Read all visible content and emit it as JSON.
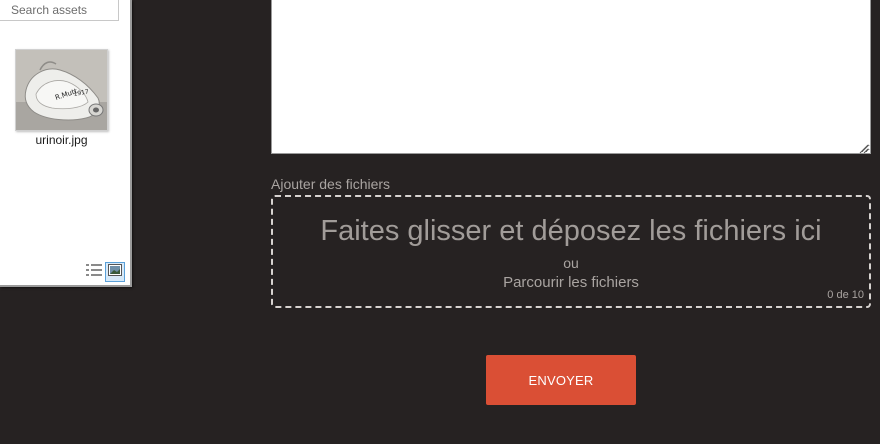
{
  "asset_panel": {
    "search_placeholder": "Search assets",
    "items": [
      {
        "filename": "urinoir.jpg",
        "icon": "image-thumbnail"
      }
    ],
    "view_modes": [
      {
        "icon": "list-view-icon",
        "active": false
      },
      {
        "icon": "thumbnail-view-icon",
        "active": true
      }
    ]
  },
  "form": {
    "message_value": "",
    "files_label": "Ajouter des fichiers",
    "dropzone": {
      "title": "Faites glisser et déposez les fichiers ici",
      "or_text": "ou",
      "browse_text": "Parcourir les fichiers",
      "file_count": "0 de 10"
    },
    "submit_label": "ENVOYER"
  },
  "colors": {
    "background": "#262222",
    "accent_button": "#da4f35",
    "muted_text": "#a9a4a1",
    "dropzone_border": "#d7d3d0"
  }
}
